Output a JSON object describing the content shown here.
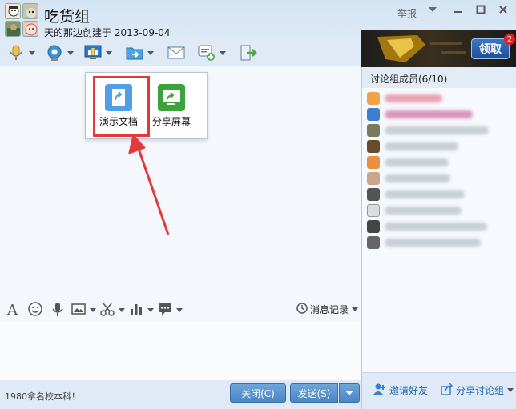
{
  "title": {
    "group_name": "吃货组",
    "subtitle": "天的那边创建于 2013-09-04",
    "report": "举报"
  },
  "popup": {
    "options": [
      {
        "label": "演示文档",
        "icon": "presentation-doc-icon"
      },
      {
        "label": "分享屏幕",
        "icon": "share-screen-icon"
      }
    ]
  },
  "edit_toolbar": {
    "message_record": "消息记录"
  },
  "bottom": {
    "slogan": "1980拿名校本科！",
    "close_label": "关闭(C)",
    "send_label": "发送(S)"
  },
  "right": {
    "ad_button": "领取",
    "ad_badge": "2",
    "members_header": "讨论组成员(6/10)",
    "invite_label": "邀请好友",
    "share_label": "分享讨论组"
  },
  "colors": {
    "accent": "#4a86c6",
    "highlight": "#e23a3a",
    "background": "#dde9f5"
  }
}
